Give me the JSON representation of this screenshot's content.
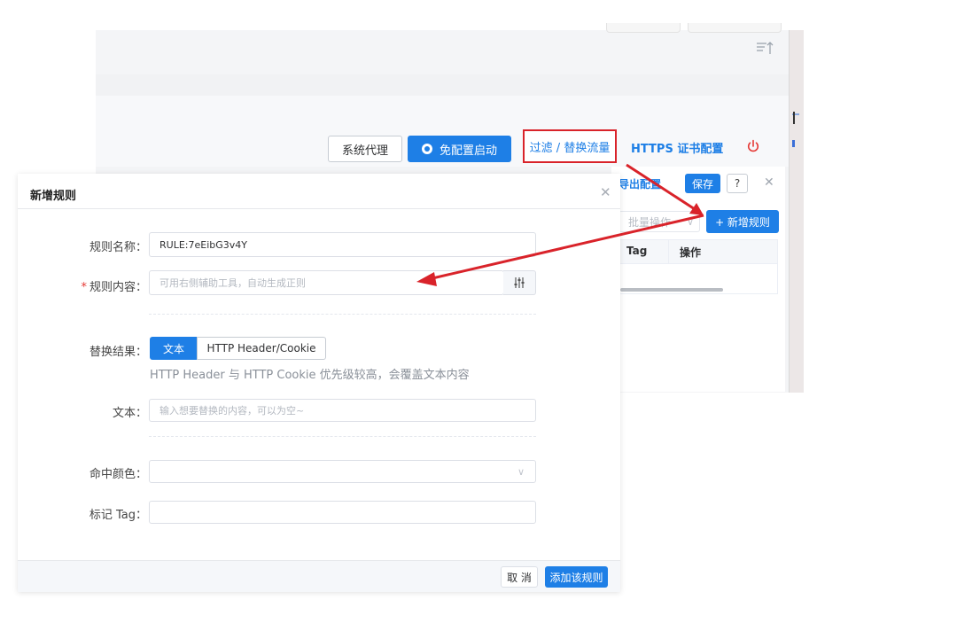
{
  "toolbar": {
    "system_proxy": "系统代理",
    "free_config_start": "免配置启动",
    "filter_replace": "过滤 / 替换流量",
    "https_config": "HTTPS 证书配置",
    "power_icon": "power-icon",
    "sort_icon": "sort-icon",
    "chrome_icon": "chrome-icon"
  },
  "rules_panel": {
    "export_config": "导出配置",
    "save": "保存",
    "help_symbol": "?",
    "batch_placeholder": "批量操作",
    "add_rule": "+ 新增规则",
    "columns": [
      "Tag",
      "操作"
    ]
  },
  "dialog": {
    "title": "新增规则",
    "fields": {
      "name_label": "规则名称：",
      "name_value": "RULE:7eEibG3v4Y",
      "content_label": "规则内容：",
      "content_placeholder": "可用右侧辅助工具，自动生成正则",
      "regex_tool_icon": "regex-tool-icon",
      "replace_label": "替换结果：",
      "replace_options": [
        "文本",
        "HTTP Header/Cookie"
      ],
      "replace_selected": "文本",
      "replace_hint": "HTTP Header 与 HTTP Cookie 优先级较高，会覆盖文本内容",
      "text_label": "文本：",
      "text_placeholder": "输入想要替换的内容，可以为空~",
      "color_label": "命中颜色：",
      "tag_label": "标记 Tag："
    },
    "footer": {
      "cancel": "取 消",
      "confirm": "添加该规则"
    }
  },
  "colors": {
    "primary": "#1e7fe6",
    "highlight_red": "#d9232a",
    "required_star": "#e53935"
  }
}
